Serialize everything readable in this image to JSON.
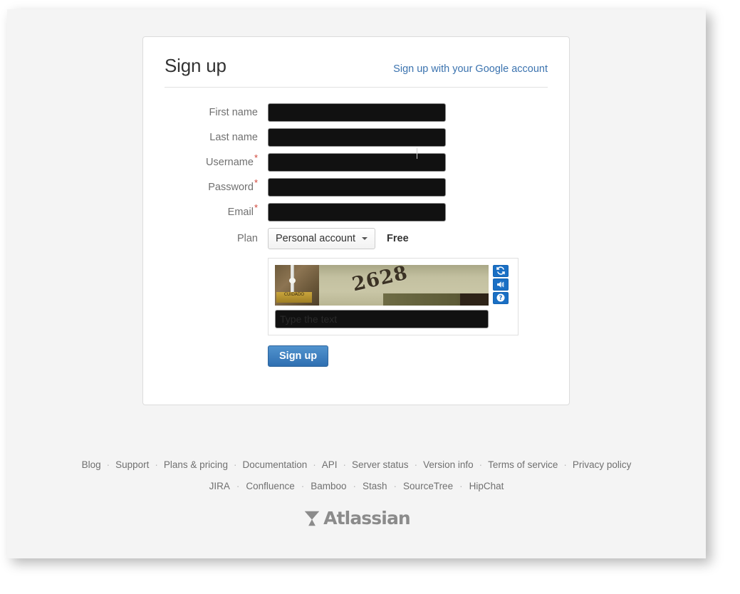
{
  "page": {
    "background_color": "#f4f4f4",
    "card_background": "#ffffff"
  },
  "card": {
    "title": "Sign up",
    "google_link": "Sign up with your Google account",
    "link_color": "#3b73af"
  },
  "form": {
    "fields": [
      {
        "label": "First name",
        "required": false,
        "value": "",
        "redacted": true,
        "focused": true
      },
      {
        "label": "Last name",
        "required": false,
        "value": "",
        "redacted": true,
        "focused": false
      },
      {
        "label": "Username",
        "required": true,
        "value": "",
        "redacted": true,
        "focused": false
      },
      {
        "label": "Password",
        "required": true,
        "value": "",
        "redacted": true,
        "focused": false
      },
      {
        "label": "Email",
        "required": true,
        "value": "",
        "redacted": true,
        "focused": false
      }
    ],
    "required_marker": "*",
    "required_color": "#d04437",
    "plan": {
      "label": "Plan",
      "selected": "Personal account",
      "options": [
        "Personal account"
      ],
      "price": "Free"
    },
    "captcha": {
      "image_text": "2628",
      "image_sign_text": "CUIDADO",
      "input_placeholder": "Type the text",
      "input_value": "",
      "buttons": [
        {
          "name": "refresh-icon",
          "title": "Get a new challenge"
        },
        {
          "name": "audio-icon",
          "title": "Get an audio challenge"
        },
        {
          "name": "help-icon",
          "title": "Help"
        }
      ],
      "button_color": "#1a6fc4"
    },
    "submit_label": "Sign up",
    "submit_color": "#3b7fc0"
  },
  "footer": {
    "separator": "·",
    "row1": [
      "Blog",
      "Support",
      "Plans & pricing",
      "Documentation",
      "API",
      "Server status",
      "Version info",
      "Terms of service",
      "Privacy policy"
    ],
    "row2": [
      "JIRA",
      "Confluence",
      "Bamboo",
      "Stash",
      "SourceTree",
      "HipChat"
    ],
    "logo_text": "Atlassian"
  }
}
